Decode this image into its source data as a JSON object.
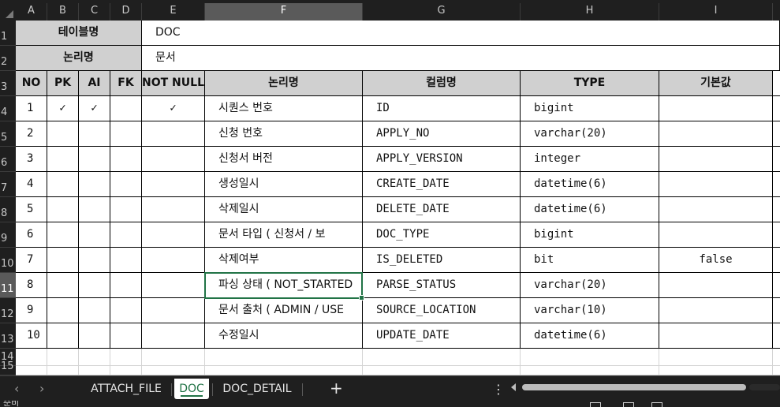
{
  "columns": [
    "A",
    "B",
    "C",
    "D",
    "E",
    "F",
    "G",
    "H",
    "I"
  ],
  "selected_column": "F",
  "rows": [
    "1",
    "2",
    "3",
    "4",
    "5",
    "6",
    "7",
    "8",
    "9",
    "10",
    "11",
    "12",
    "13",
    "14",
    "15"
  ],
  "selected_row": "11",
  "meta": {
    "table_name_label": "테이블명",
    "table_name_value": "DOC",
    "logical_name_label": "논리명",
    "logical_name_value": "문서"
  },
  "header": {
    "no": "NO",
    "pk": "PK",
    "ai": "AI",
    "fk": "FK",
    "not_null": "NOT NULL",
    "logical_name": "논리명",
    "column_name": "컬럼명",
    "type": "TYPE",
    "default": "기본값"
  },
  "data_rows": [
    {
      "no": "1",
      "pk": "✓",
      "ai": "✓",
      "fk": "",
      "nn": "✓",
      "logical": "시퀀스 번호",
      "column": "ID",
      "type": "bigint",
      "default": ""
    },
    {
      "no": "2",
      "pk": "",
      "ai": "",
      "fk": "",
      "nn": "",
      "logical": "신청 번호",
      "column": "APPLY_NO",
      "type": "varchar(20)",
      "default": ""
    },
    {
      "no": "3",
      "pk": "",
      "ai": "",
      "fk": "",
      "nn": "",
      "logical": "신청서 버전",
      "column": "APPLY_VERSION",
      "type": "integer",
      "default": ""
    },
    {
      "no": "4",
      "pk": "",
      "ai": "",
      "fk": "",
      "nn": "",
      "logical": "생성일시",
      "column": "CREATE_DATE",
      "type": "datetime(6)",
      "default": ""
    },
    {
      "no": "5",
      "pk": "",
      "ai": "",
      "fk": "",
      "nn": "",
      "logical": "삭제일시",
      "column": "DELETE_DATE",
      "type": "datetime(6)",
      "default": ""
    },
    {
      "no": "6",
      "pk": "",
      "ai": "",
      "fk": "",
      "nn": "",
      "logical": "문서 타입 ( 신청서 / 보",
      "column": "DOC_TYPE",
      "type": "bigint",
      "default": ""
    },
    {
      "no": "7",
      "pk": "",
      "ai": "",
      "fk": "",
      "nn": "",
      "logical": "삭제여부",
      "column": "IS_DELETED",
      "type": "bit",
      "default": "false"
    },
    {
      "no": "8",
      "pk": "",
      "ai": "",
      "fk": "",
      "nn": "",
      "logical": "파싱 상태 ( NOT_STARTED",
      "column": "PARSE_STATUS",
      "type": "varchar(20)",
      "default": ""
    },
    {
      "no": "9",
      "pk": "",
      "ai": "",
      "fk": "",
      "nn": "",
      "logical": "문서 출처 ( ADMIN / USE",
      "column": "SOURCE_LOCATION",
      "type": "varchar(10)",
      "default": ""
    },
    {
      "no": "10",
      "pk": "",
      "ai": "",
      "fk": "",
      "nn": "",
      "logical": "수정일시",
      "column": "UPDATE_DATE",
      "type": "datetime(6)",
      "default": ""
    }
  ],
  "sheet_tabs": [
    "ATTACH_FILE",
    "DOC",
    "DOC_DETAIL"
  ],
  "active_sheet": "DOC",
  "nav": {
    "prev": "‹",
    "next": "›",
    "add": "+",
    "more": "⋮"
  },
  "status": {
    "text": "준비"
  },
  "colors": {
    "accent": "#217346",
    "header_fill": "#d0d0d0",
    "chrome": "#1f1f1f"
  }
}
